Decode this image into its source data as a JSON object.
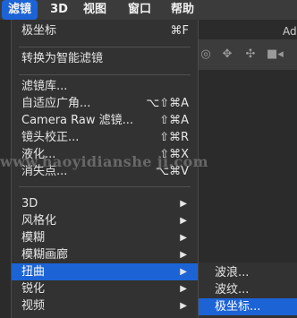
{
  "menubar": {
    "items": [
      "滤镜",
      "3D",
      "视图",
      "窗口",
      "帮助"
    ],
    "right_text": "Ad"
  },
  "app": {
    "right_text_top": "Ad",
    "right_text_mid": "",
    "toolbar_icons": [
      "target-icon",
      "move-icon",
      "cross-icon",
      "video-icon"
    ]
  },
  "filter_menu": {
    "last_filter": {
      "label": "极坐标",
      "shortcut": "⌘F"
    },
    "smart_filters": {
      "label": "转换为智能滤镜"
    },
    "gallery": {
      "label": "滤镜库..."
    },
    "adaptive_wide": {
      "label": "自适应广角...",
      "shortcut": "⌥⇧⌘A"
    },
    "camera_raw": {
      "label": "Camera Raw 滤镜...",
      "shortcut": "⇧⌘A"
    },
    "lens_correction": {
      "label": "镜头校正...",
      "shortcut": "⇧⌘R"
    },
    "liquify": {
      "label": "液化...",
      "shortcut": "⇧⌘X"
    },
    "vanishing_point": {
      "label": "消失点...",
      "shortcut": "⌥⌘V"
    },
    "groups": [
      {
        "label": "3D"
      },
      {
        "label": "风格化"
      },
      {
        "label": "模糊"
      },
      {
        "label": "模糊画廊"
      },
      {
        "label": "扭曲"
      },
      {
        "label": "锐化"
      },
      {
        "label": "视频"
      }
    ]
  },
  "distort_submenu": {
    "items": [
      "波浪...",
      "波纹...",
      "极坐标..."
    ]
  },
  "watermark": "www.haoyidianshe ji.com",
  "colors": {
    "highlight": "#1c63d6",
    "menu_bg": "#323232"
  }
}
